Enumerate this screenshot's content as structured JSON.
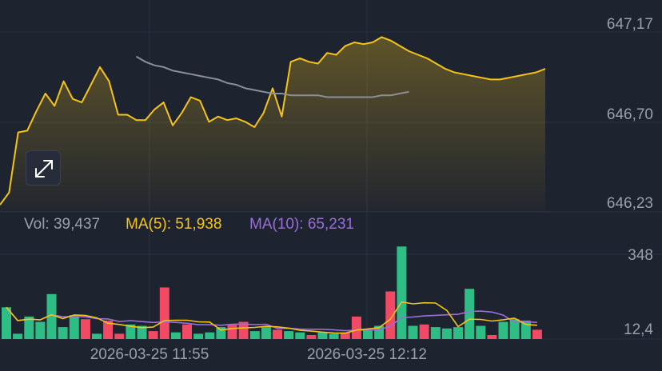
{
  "colors": {
    "background": "#1e2330",
    "grid": "#2c3240",
    "price_line": "#f5c417",
    "ma_price_line": "#8a8f98",
    "up": "#2ebd85",
    "down": "#f04a65",
    "ma5": "#f5c417",
    "ma10": "#9a6ed8",
    "label": "#9aa0ab"
  },
  "controls": {
    "expand_icon": "expand-arrows-icon"
  },
  "legend": {
    "vol_label": "Vol: 39,437",
    "ma5_label": "MA(5): 51,938",
    "ma10_label": "MA(10): 65,231"
  },
  "chart_data": [
    {
      "type": "area",
      "series": [
        {
          "values": [
            646.25,
            646.32,
            646.66,
            646.67,
            646.78,
            646.88,
            646.81,
            646.95,
            646.85,
            646.83,
            646.93,
            647.03,
            646.95,
            646.76,
            646.76,
            646.73,
            646.73,
            646.79,
            646.83,
            646.7,
            646.77,
            646.86,
            646.84,
            646.72,
            646.75,
            646.73,
            646.74,
            646.72,
            646.69,
            646.77,
            646.91,
            646.75,
            647.06,
            647.08,
            647.06,
            647.05,
            647.11,
            647.1,
            647.15,
            647.17,
            647.16,
            647.17,
            647.2,
            647.18,
            647.15,
            647.12,
            647.1,
            647.08,
            647.05,
            647.02,
            647.0,
            646.99,
            646.98,
            646.97,
            646.96,
            646.96,
            646.97,
            646.98,
            646.99,
            647.0,
            647.02
          ]
        },
        {
          "values": [
            null,
            null,
            null,
            null,
            null,
            null,
            null,
            null,
            null,
            null,
            null,
            null,
            null,
            null,
            null,
            647.09,
            647.06,
            647.04,
            647.03,
            647.01,
            647.0,
            646.99,
            646.98,
            646.97,
            646.96,
            646.94,
            646.93,
            646.91,
            646.9,
            646.89,
            646.88,
            646.88,
            646.87,
            646.87,
            646.87,
            646.87,
            646.86,
            646.86,
            646.86,
            646.86,
            646.86,
            646.86,
            646.87,
            646.87,
            646.88,
            646.89
          ]
        }
      ],
      "x_ticks": [
        "2026-03-25 11:55",
        "2026-03-25 12:12"
      ],
      "y_ticks": [
        "647,17",
        "646,70",
        "646,23"
      ],
      "ylim": [
        646.21,
        647.41
      ]
    },
    {
      "type": "bar",
      "series": [
        {
          "name": "volume",
          "values": [
            48,
            8,
            34,
            26,
            68,
            18,
            36,
            30,
            8,
            28,
            8,
            22,
            20,
            12,
            78,
            10,
            22,
            8,
            10,
            18,
            22,
            26,
            12,
            18,
            14,
            12,
            10,
            6,
            10,
            8,
            10,
            34,
            14,
            20,
            72,
            140,
            20,
            22,
            18,
            16,
            18,
            76,
            20,
            6,
            26,
            30,
            28,
            14
          ],
          "direction": [
            "up",
            "up",
            "up",
            "up",
            "up",
            "up",
            "up",
            "down",
            "up",
            "down",
            "down",
            "up",
            "up",
            "down",
            "down",
            "up",
            "down",
            "up",
            "up",
            "up",
            "down",
            "down",
            "up",
            "up",
            "down",
            "up",
            "up",
            "down",
            "up",
            "up",
            "down",
            "down",
            "up",
            "up",
            "down",
            "up",
            "up",
            "down",
            "up",
            "up",
            "up",
            "up",
            "up",
            "down",
            "up",
            "up",
            "up",
            "down"
          ]
        },
        {
          "name": "MA(5)",
          "values": [
            null,
            null,
            null,
            null,
            null,
            null,
            null,
            null,
            null,
            null,
            null,
            null,
            null,
            null,
            null,
            null,
            null,
            null,
            null,
            null,
            null,
            null,
            null,
            null,
            null,
            null,
            null,
            null,
            null,
            null,
            null,
            null,
            null,
            null,
            null,
            null,
            null,
            null,
            null,
            null,
            null,
            null,
            null,
            null,
            null,
            null,
            null,
            null
          ]
        },
        {
          "name": "MA(10)",
          "values": [
            null,
            null,
            null,
            null,
            null,
            null,
            null,
            null,
            null,
            null,
            null,
            null,
            null,
            null,
            null,
            null,
            null,
            null,
            null,
            null,
            null,
            null,
            null,
            null,
            null,
            null,
            null,
            null,
            null,
            null,
            null,
            null,
            null,
            null,
            null,
            null,
            null,
            null,
            null,
            null,
            null,
            null,
            null,
            null,
            null,
            null,
            null,
            null
          ]
        }
      ],
      "y_ticks": [
        "348",
        "12,4"
      ],
      "ylim": [
        0,
        150
      ]
    }
  ]
}
